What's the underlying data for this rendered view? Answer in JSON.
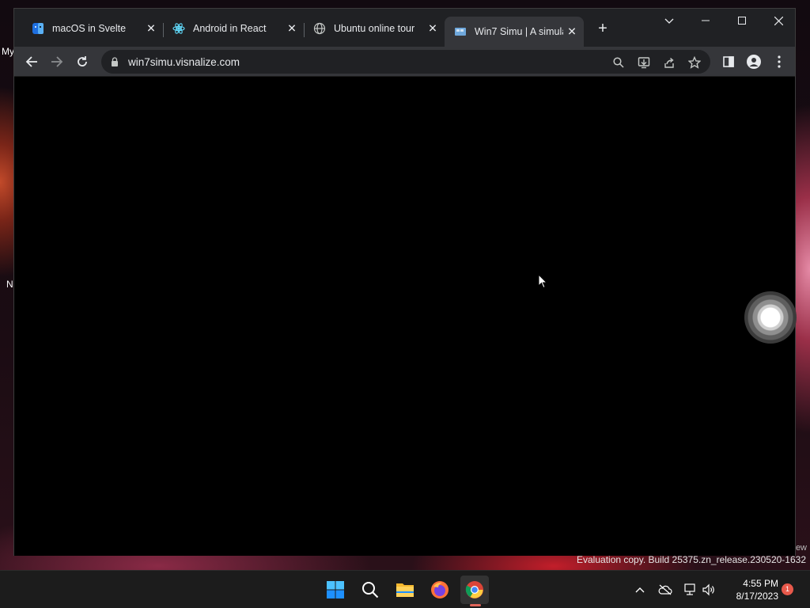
{
  "desktop": {
    "left_labels": [
      "My",
      "N"
    ]
  },
  "browser": {
    "tabs": [
      {
        "title": "macOS in Svelte",
        "icon": "macos-finder-icon"
      },
      {
        "title": "Android in React",
        "icon": "react-icon"
      },
      {
        "title": "Ubuntu online tour",
        "icon": "globe-icon"
      },
      {
        "title": "Win7 Simu | A simula",
        "icon": "win7-icon",
        "active": true
      }
    ],
    "url": "win7simu.visnalize.com"
  },
  "watermark": {
    "text": "Evaluation copy. Build 25375.zn_release.230520-1632",
    "side_text": "ew"
  },
  "taskbar": {
    "apps": [
      "windows-start-icon",
      "search-icon",
      "file-explorer-icon",
      "firefox-icon",
      "chrome-icon"
    ],
    "time": "4:55 PM",
    "date": "8/17/2023",
    "notification_count": "1"
  }
}
